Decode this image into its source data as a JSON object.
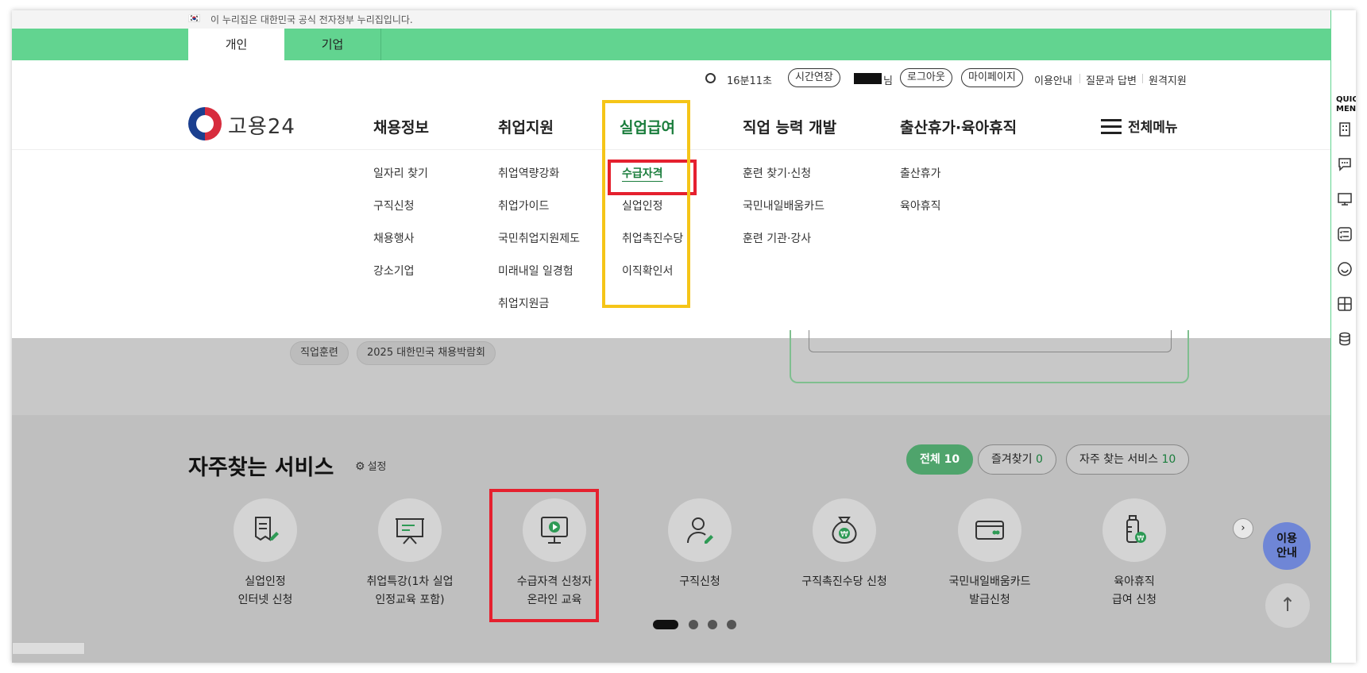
{
  "gov_banner": {
    "text": "이 누리집은 대한민국 공식 전자정부 누리집입니다."
  },
  "tabs": [
    "개인",
    "기업"
  ],
  "util": {
    "timer": "16분11초",
    "extend": "시간연장",
    "nim": "님",
    "logout": "로그아웃",
    "mypage": "마이페이지",
    "links": [
      "이용안내",
      "질문과 답변",
      "원격지원"
    ]
  },
  "logo": {
    "name": "고용24"
  },
  "gnb": {
    "items": [
      "채용정보",
      "취업지원",
      "실업급여",
      "직업 능력 개발",
      "출산휴가·육아휴직"
    ],
    "all_menu": "전체메뉴"
  },
  "submenu": {
    "col1": [
      "일자리 찾기",
      "구직신청",
      "채용행사",
      "강소기업"
    ],
    "col2": [
      "취업역량강화",
      "취업가이드",
      "국민취업지원제도",
      "미래내일 일경험",
      "취업지원금"
    ],
    "col3": [
      "수급자격",
      "실업인정",
      "취업촉진수당",
      "이직확인서"
    ],
    "col4": [
      "훈련 찾기·신청",
      "국민내일배움카드",
      "훈련 기관·강사"
    ],
    "col5": [
      "출산휴가",
      "육아휴직"
    ]
  },
  "chips": [
    "직업훈련",
    "2025 대한민국 채용박람회"
  ],
  "services": {
    "title": "자주찾는 서비스",
    "setting": "설정",
    "filters": [
      {
        "label": "전체",
        "count": "10"
      },
      {
        "label": "즐겨찾기",
        "count": "0"
      },
      {
        "label": "자주 찾는 서비스",
        "count": "10"
      }
    ],
    "items": [
      {
        "line1": "실업인정",
        "line2": "인터넷 신청",
        "icon": "document-pen-icon"
      },
      {
        "line1": "취업특강(1차 실업",
        "line2": "인정교육 포함)",
        "icon": "presentation-board-icon"
      },
      {
        "line1": "수급자격 신청자",
        "line2": "온라인 교육",
        "icon": "monitor-play-icon"
      },
      {
        "line1": "구직신청",
        "line2": "",
        "icon": "person-pen-icon"
      },
      {
        "line1": "구직촉진수당 신청",
        "line2": "",
        "icon": "money-bag-icon"
      },
      {
        "line1": "국민내일배움카드",
        "line2": "발급신청",
        "icon": "credit-card-icon"
      },
      {
        "line1": "육아휴직",
        "line2": "급여 신청",
        "icon": "baby-bottle-icon"
      }
    ],
    "guide": "이용\n안내"
  },
  "quick": {
    "title": "QUICK MENU"
  },
  "colors": {
    "green": "#62d490",
    "active_menu": "#1a7d3c",
    "highlight_yellow": "#f5c518",
    "highlight_red": "#e5202e"
  }
}
